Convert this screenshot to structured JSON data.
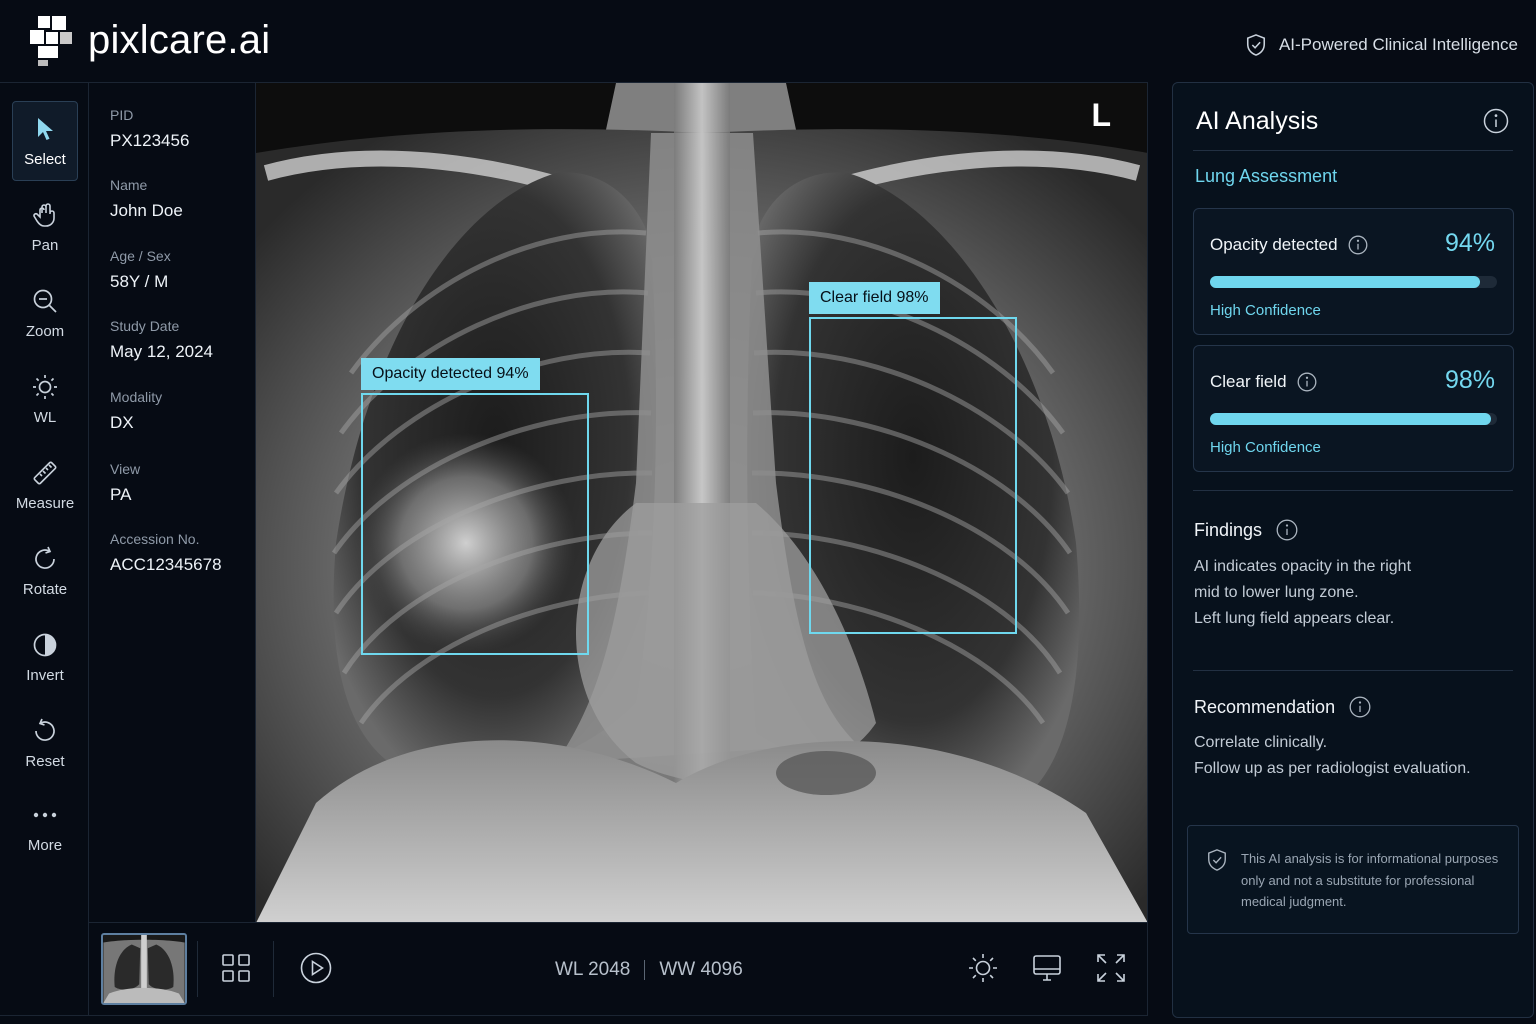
{
  "header": {
    "brand": "pixlcare.ai",
    "tagline": "AI-Powered Clinical Intelligence"
  },
  "toolbar": {
    "items": [
      {
        "label": "Select",
        "icon": "cursor-icon",
        "active": true
      },
      {
        "label": "Pan",
        "icon": "pan-icon"
      },
      {
        "label": "Zoom",
        "icon": "zoom-icon"
      },
      {
        "label": "WL",
        "icon": "brightness-icon"
      },
      {
        "label": "Measure",
        "icon": "ruler-icon"
      },
      {
        "label": "Rotate",
        "icon": "rotate-icon"
      },
      {
        "label": "Invert",
        "icon": "invert-icon"
      },
      {
        "label": "Reset",
        "icon": "reset-icon"
      },
      {
        "label": "More",
        "icon": "more-icon"
      }
    ]
  },
  "patient": {
    "pid_label": "PID",
    "pid": "PX123456",
    "name_label": "Name",
    "name": "John Doe",
    "agesex_label": "Age / Sex",
    "agesex": "58Y / M",
    "date_label": "Study Date",
    "date": "May 12, 2024",
    "modality_label": "Modality",
    "modality": "DX",
    "view_label": "View",
    "view": "PA",
    "accession_label": "Accession No.",
    "accession": "ACC12345678"
  },
  "viewer": {
    "orientation": "L",
    "annotations": [
      {
        "label": "Opacity detected 94%"
      },
      {
        "label": "Clear field 98%"
      }
    ]
  },
  "bottombar": {
    "wl": "WL 2048",
    "ww": "WW 4096"
  },
  "analysis": {
    "title": "AI Analysis",
    "subtitle": "Lung Assessment",
    "cards": [
      {
        "title": "Opacity detected",
        "percent": "94%",
        "value": 0.94,
        "confidence": "High Confidence"
      },
      {
        "title": "Clear field",
        "percent": "98%",
        "value": 0.98,
        "confidence": "High Confidence"
      }
    ],
    "findings_title": "Findings",
    "findings": [
      "AI indicates opacity in the right",
      "mid to lower lung zone.",
      "Left lung field appears clear."
    ],
    "recommendation_title": "Recommendation",
    "recommendation": [
      "Correlate clinically.",
      "Follow up as per radiologist evaluation."
    ],
    "disclaimer": "This AI analysis is for informational purposes only and not a substitute for professional medical judgment."
  },
  "colors": {
    "accent": "#6fd6ee",
    "background": "#060b14"
  }
}
